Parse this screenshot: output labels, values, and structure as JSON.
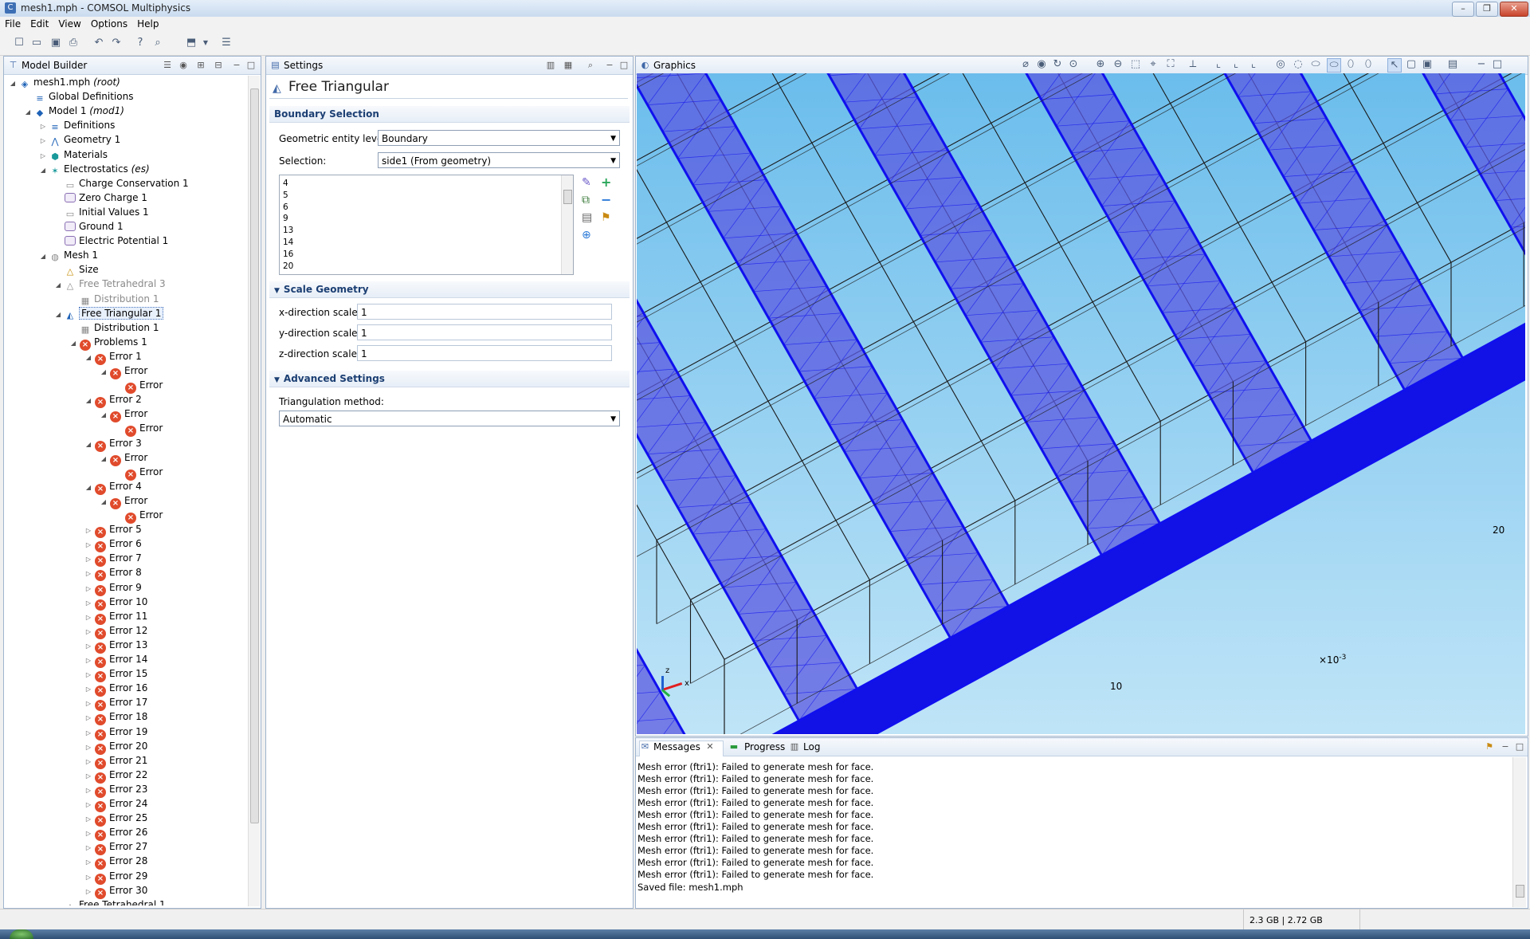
{
  "window": {
    "title": "mesh1.mph - COMSOL Multiphysics",
    "controls": [
      "–",
      "❐",
      "✕"
    ]
  },
  "menu": [
    "File",
    "Edit",
    "View",
    "Options",
    "Help"
  ],
  "model_builder": {
    "title": "Model Builder",
    "items": [
      {
        "label": "mesh1.mph",
        "em": "(root)",
        "indent": 0,
        "arrow": "◢",
        "icon": "file-icon"
      },
      {
        "label": "Global Definitions",
        "indent": 1,
        "arrow": "",
        "icon": "global-definitions-icon"
      },
      {
        "label": "Model 1",
        "em": "(mod1)",
        "indent": 1,
        "arrow": "◢",
        "icon": "model-icon"
      },
      {
        "label": "Definitions",
        "indent": 2,
        "arrow": "▷",
        "icon": "definitions-icon"
      },
      {
        "label": "Geometry 1",
        "indent": 2,
        "arrow": "▷",
        "icon": "geometry-icon"
      },
      {
        "label": "Materials",
        "indent": 2,
        "arrow": "▷",
        "icon": "materials-icon"
      },
      {
        "label": "Electrostatics",
        "em": "(es)",
        "indent": 2,
        "arrow": "◢",
        "icon": "electrostatics-icon"
      },
      {
        "label": "Charge Conservation 1",
        "indent": 3,
        "arrow": "",
        "icon": "node-icon"
      },
      {
        "label": "Zero Charge 1",
        "indent": 3,
        "arrow": "",
        "icon": "boundary-node-icon"
      },
      {
        "label": "Initial Values 1",
        "indent": 3,
        "arrow": "",
        "icon": "node-icon"
      },
      {
        "label": "Ground 1",
        "indent": 3,
        "arrow": "",
        "icon": "boundary-node-icon"
      },
      {
        "label": "Electric Potential 1",
        "indent": 3,
        "arrow": "",
        "icon": "boundary-node-icon"
      },
      {
        "label": "Mesh 1",
        "indent": 2,
        "arrow": "◢",
        "icon": "mesh-icon"
      },
      {
        "label": "Size",
        "indent": 3,
        "arrow": "",
        "icon": "size-icon"
      },
      {
        "label": "Free Tetrahedral 3",
        "indent": 3,
        "arrow": "◢",
        "icon": "tetrahedral-icon",
        "grey": true
      },
      {
        "label": "Distribution 1",
        "indent": 4,
        "arrow": "",
        "icon": "distribution-icon",
        "grey": true
      },
      {
        "label": "Free Triangular 1",
        "indent": 3,
        "arrow": "◢",
        "icon": "triangular-icon",
        "selected": true
      },
      {
        "label": "Distribution 1",
        "indent": 4,
        "arrow": "",
        "icon": "distribution-icon"
      },
      {
        "label": "Problems 1",
        "indent": 4,
        "arrow": "◢",
        "icon": "error-icon"
      },
      {
        "label": "Error 1",
        "indent": 5,
        "arrow": "◢",
        "icon": "error-icon"
      },
      {
        "label": "Error",
        "indent": 6,
        "arrow": "◢",
        "icon": "error-icon"
      },
      {
        "label": "Error",
        "indent": 7,
        "arrow": "",
        "icon": "error-icon"
      },
      {
        "label": "Error 2",
        "indent": 5,
        "arrow": "◢",
        "icon": "error-icon"
      },
      {
        "label": "Error",
        "indent": 6,
        "arrow": "◢",
        "icon": "error-icon"
      },
      {
        "label": "Error",
        "indent": 7,
        "arrow": "",
        "icon": "error-icon"
      },
      {
        "label": "Error 3",
        "indent": 5,
        "arrow": "◢",
        "icon": "error-icon"
      },
      {
        "label": "Error",
        "indent": 6,
        "arrow": "◢",
        "icon": "error-icon"
      },
      {
        "label": "Error",
        "indent": 7,
        "arrow": "",
        "icon": "error-icon"
      },
      {
        "label": "Error 4",
        "indent": 5,
        "arrow": "◢",
        "icon": "error-icon"
      },
      {
        "label": "Error",
        "indent": 6,
        "arrow": "◢",
        "icon": "error-icon"
      },
      {
        "label": "Error",
        "indent": 7,
        "arrow": "",
        "icon": "error-icon"
      },
      {
        "label": "Error 5",
        "indent": 5,
        "arrow": "▷",
        "icon": "error-icon"
      },
      {
        "label": "Error 6",
        "indent": 5,
        "arrow": "▷",
        "icon": "error-icon"
      },
      {
        "label": "Error 7",
        "indent": 5,
        "arrow": "▷",
        "icon": "error-icon"
      },
      {
        "label": "Error 8",
        "indent": 5,
        "arrow": "▷",
        "icon": "error-icon"
      },
      {
        "label": "Error 9",
        "indent": 5,
        "arrow": "▷",
        "icon": "error-icon"
      },
      {
        "label": "Error 10",
        "indent": 5,
        "arrow": "▷",
        "icon": "error-icon"
      },
      {
        "label": "Error 11",
        "indent": 5,
        "arrow": "▷",
        "icon": "error-icon"
      },
      {
        "label": "Error 12",
        "indent": 5,
        "arrow": "▷",
        "icon": "error-icon"
      },
      {
        "label": "Error 13",
        "indent": 5,
        "arrow": "▷",
        "icon": "error-icon"
      },
      {
        "label": "Error 14",
        "indent": 5,
        "arrow": "▷",
        "icon": "error-icon"
      },
      {
        "label": "Error 15",
        "indent": 5,
        "arrow": "▷",
        "icon": "error-icon"
      },
      {
        "label": "Error 16",
        "indent": 5,
        "arrow": "▷",
        "icon": "error-icon"
      },
      {
        "label": "Error 17",
        "indent": 5,
        "arrow": "▷",
        "icon": "error-icon"
      },
      {
        "label": "Error 18",
        "indent": 5,
        "arrow": "▷",
        "icon": "error-icon"
      },
      {
        "label": "Error 19",
        "indent": 5,
        "arrow": "▷",
        "icon": "error-icon"
      },
      {
        "label": "Error 20",
        "indent": 5,
        "arrow": "▷",
        "icon": "error-icon"
      },
      {
        "label": "Error 21",
        "indent": 5,
        "arrow": "▷",
        "icon": "error-icon"
      },
      {
        "label": "Error 22",
        "indent": 5,
        "arrow": "▷",
        "icon": "error-icon"
      },
      {
        "label": "Error 23",
        "indent": 5,
        "arrow": "▷",
        "icon": "error-icon"
      },
      {
        "label": "Error 24",
        "indent": 5,
        "arrow": "▷",
        "icon": "error-icon"
      },
      {
        "label": "Error 25",
        "indent": 5,
        "arrow": "▷",
        "icon": "error-icon"
      },
      {
        "label": "Error 26",
        "indent": 5,
        "arrow": "▷",
        "icon": "error-icon"
      },
      {
        "label": "Error 27",
        "indent": 5,
        "arrow": "▷",
        "icon": "error-icon"
      },
      {
        "label": "Error 28",
        "indent": 5,
        "arrow": "▷",
        "icon": "error-icon"
      },
      {
        "label": "Error 29",
        "indent": 5,
        "arrow": "▷",
        "icon": "error-icon"
      },
      {
        "label": "Error 30",
        "indent": 5,
        "arrow": "▷",
        "icon": "error-icon"
      },
      {
        "label": "Free Tetrahedral 1",
        "indent": 3,
        "arrow": "",
        "icon": "tetrahedral-icon"
      }
    ]
  },
  "settings": {
    "tab": "Settings",
    "title": "Free Triangular",
    "boundary_selection": {
      "header": "Boundary Selection",
      "entity_level_label": "Geometric entity level:",
      "entity_level_value": "Boundary",
      "selection_label": "Selection:",
      "selection_value": "side1 (From geometry)",
      "list": [
        "4",
        "5",
        "6",
        "9",
        "13",
        "14",
        "16",
        "20"
      ]
    },
    "scale_geometry": {
      "header": "Scale Geometry",
      "x_label": "x-direction scale:",
      "x_value": "1",
      "y_label": "y-direction scale:",
      "y_value": "1",
      "z_label": "z-direction scale:",
      "z_value": "1"
    },
    "advanced": {
      "header": "Advanced Settings",
      "method_label": "Triangulation method:",
      "method_value": "Automatic"
    }
  },
  "graphics": {
    "tab": "Graphics",
    "label_20": "20",
    "label_10": "10",
    "label_scale": "×10",
    "label_scale_exp": "-3",
    "axis_x": "x",
    "axis_z": "z"
  },
  "messages": {
    "tabs": [
      "Messages",
      "Progress",
      "Log"
    ],
    "lines": [
      "Mesh error (ftri1): Failed to generate mesh for face.",
      "Mesh error (ftri1): Failed to generate mesh for face.",
      "Mesh error (ftri1): Failed to generate mesh for face.",
      "Mesh error (ftri1): Failed to generate mesh for face.",
      "Mesh error (ftri1): Failed to generate mesh for face.",
      "Mesh error (ftri1): Failed to generate mesh for face.",
      "Mesh error (ftri1): Failed to generate mesh for face.",
      "Mesh error (ftri1): Failed to generate mesh for face.",
      "Mesh error (ftri1): Failed to generate mesh for face.",
      "Mesh error (ftri1): Failed to generate mesh for face.",
      "Saved file: mesh1.mph"
    ]
  },
  "status": {
    "memory": "2.3 GB | 2.72 GB"
  },
  "colors": {
    "mesh_blue": "#1010ee",
    "sky_top": "#6bbdec",
    "sky_bottom": "#bfe4f7",
    "error_red": "#e04b2c"
  }
}
